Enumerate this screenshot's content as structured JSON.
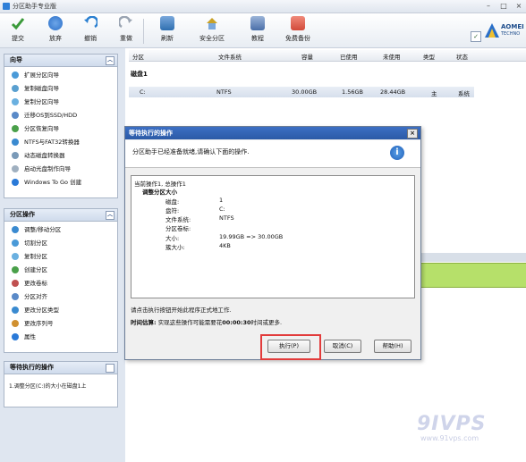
{
  "window": {
    "title": "分区助手专业版"
  },
  "toolbar": {
    "items": [
      {
        "label": "提交",
        "color": "#3a9a3a"
      },
      {
        "label": "放弃",
        "color": "#2a6fc9"
      },
      {
        "label": "撤销",
        "color": "#2a7fd0"
      },
      {
        "label": "重做",
        "color": "#9aa4b2"
      },
      {
        "label": "刷新",
        "color": "#2f6fb0"
      },
      {
        "label": "安全分区",
        "color": "#c9a227"
      },
      {
        "label": "教程",
        "color": "#4a6fa8"
      },
      {
        "label": "免费备份",
        "color": "#d24a3a"
      }
    ],
    "logo_text": "AOMEI",
    "logo_sub": "TECHNO"
  },
  "wizard_panel": {
    "title": "向导",
    "items": [
      "扩展分区向导",
      "复制磁盘向导",
      "复制分区向导",
      "迁移OS到SSD/HDD",
      "分区恢复向导",
      "NTFS与FAT32转换器",
      "动态磁盘转换器",
      "启动光盘制作向导",
      "Windows To Go 创建"
    ]
  },
  "partition_panel": {
    "title": "分区操作",
    "items": [
      "调整/移动分区",
      "切割分区",
      "复制分区",
      "创建分区",
      "更改卷标",
      "分区对齐",
      "更改分区类型",
      "更改序列号",
      "属性"
    ]
  },
  "pending_panel": {
    "title": "等待执行的操作",
    "items": [
      "1.调整分区(C:)的大小在磁盘1上"
    ]
  },
  "table": {
    "headers": [
      "分区",
      "文件系统",
      "容量",
      "已使用",
      "未使用",
      "类型",
      "状态"
    ],
    "disk_label": "磁盘1",
    "rows": [
      {
        "partition": "C:",
        "fs": "NTFS",
        "capacity": "30.00GB",
        "used": "1.56GB",
        "unused": "28.44GB",
        "type": "主",
        "status": "系统"
      }
    ]
  },
  "dialog": {
    "title": "等待执行的操作",
    "message": "分区助手已经准备就绪,请确认下面的操作.",
    "ops_header": "当前操作1, 总操作1",
    "op_title": "调整分区大小",
    "fields": [
      {
        "k": "磁盘:",
        "v": "1"
      },
      {
        "k": "盘符:",
        "v": "C:"
      },
      {
        "k": "文件系统:",
        "v": "NTFS"
      },
      {
        "k": "分区卷标:",
        "v": ""
      },
      {
        "k": "大小:",
        "v": "19.99GB => 30.00GB"
      },
      {
        "k": "簇大小:",
        "v": "4KB"
      }
    ],
    "hint": "请点击执行按钮开始此程序正式地工作.",
    "time_label": "时间估算:",
    "time_text": "实现这些操作可能需要花",
    "time_value": "00:00:30",
    "time_suffix": "时间或更多.",
    "buttons": {
      "execute": "执行(P)",
      "cancel": "取消(C)",
      "help": "帮助(H)"
    }
  },
  "watermark": {
    "brand": "9IVPS",
    "url": "www.91vps.com"
  }
}
